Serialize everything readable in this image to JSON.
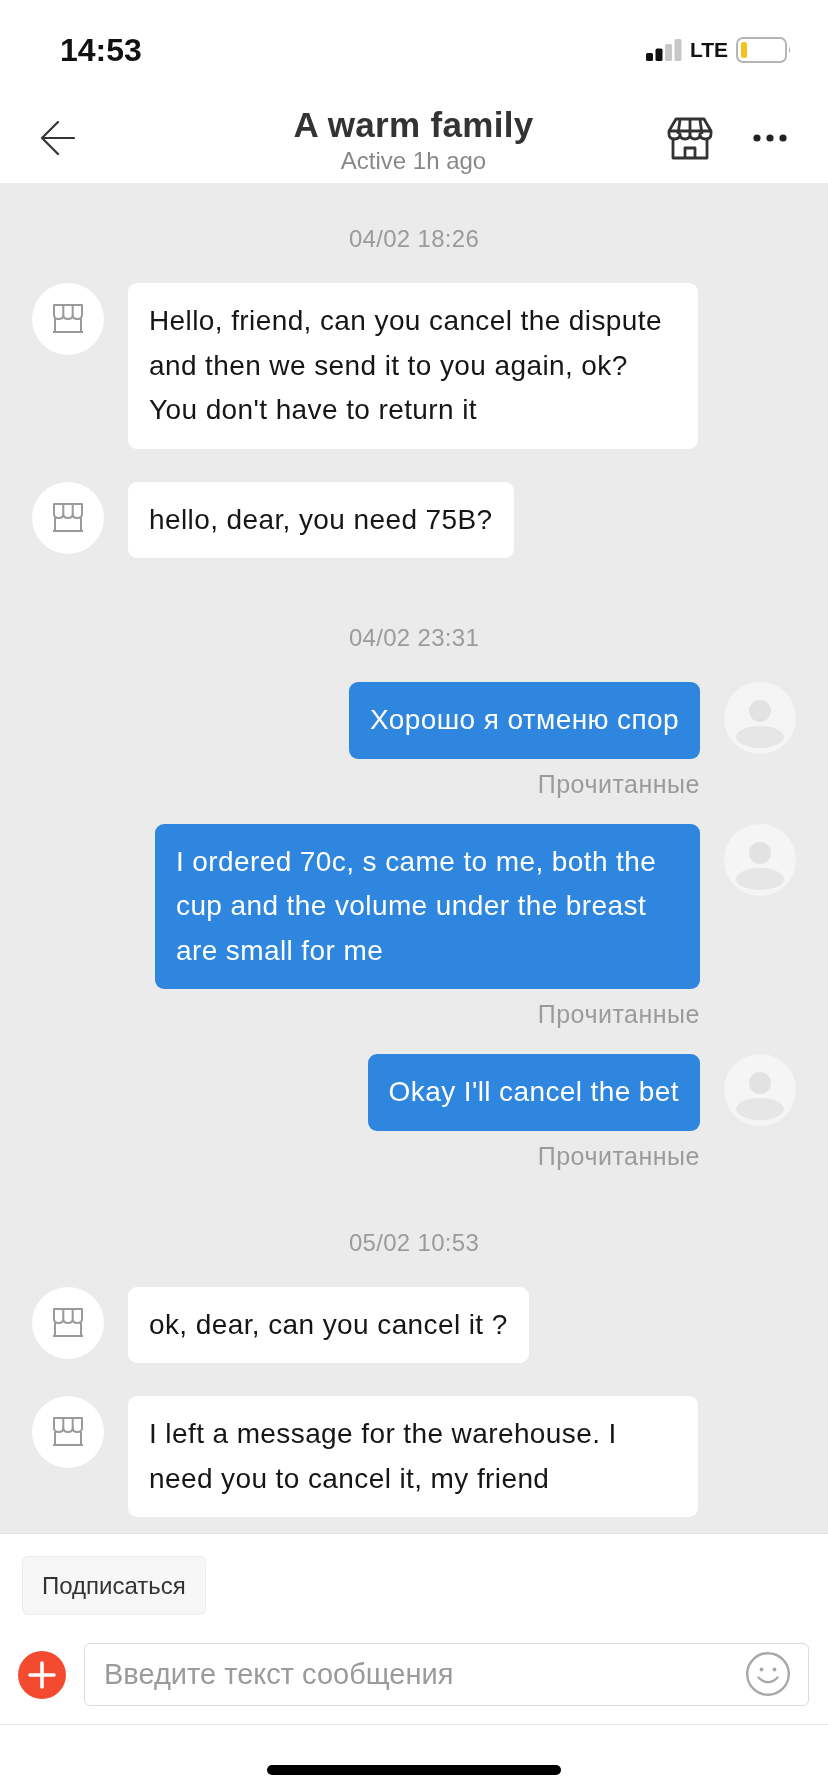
{
  "status_bar": {
    "time": "14:53",
    "network": "LTE"
  },
  "header": {
    "title": "A warm family",
    "subtitle": "Active 1h ago"
  },
  "messages": [
    {
      "kind": "timestamp",
      "text": "04/02 18:26"
    },
    {
      "kind": "received",
      "text": "Hello, friend, can you cancel the dispute and then we send it to you again, ok? You don't have to return it"
    },
    {
      "kind": "received",
      "text": "hello, dear, you need 75B?"
    },
    {
      "kind": "timestamp",
      "text": "04/02 23:31"
    },
    {
      "kind": "sent",
      "text": "Хорошо я отменю спор",
      "receipt": "Прочитанные"
    },
    {
      "kind": "sent",
      "text": "I ordered 70c, s came to me, both the cup and the volume under the breast are small for me",
      "receipt": "Прочитанные"
    },
    {
      "kind": "sent",
      "text": "Okay I'll cancel the bet",
      "receipt": "Прочитанные"
    },
    {
      "kind": "timestamp",
      "text": "05/02 10:53"
    },
    {
      "kind": "received",
      "text": "ok, dear, can you cancel it ?"
    },
    {
      "kind": "received",
      "text": "I left a message for the warehouse. I need you to cancel it, my friend"
    }
  ],
  "subscribe_button": "Подписаться",
  "composer": {
    "placeholder": "Введите текст сообщения"
  }
}
